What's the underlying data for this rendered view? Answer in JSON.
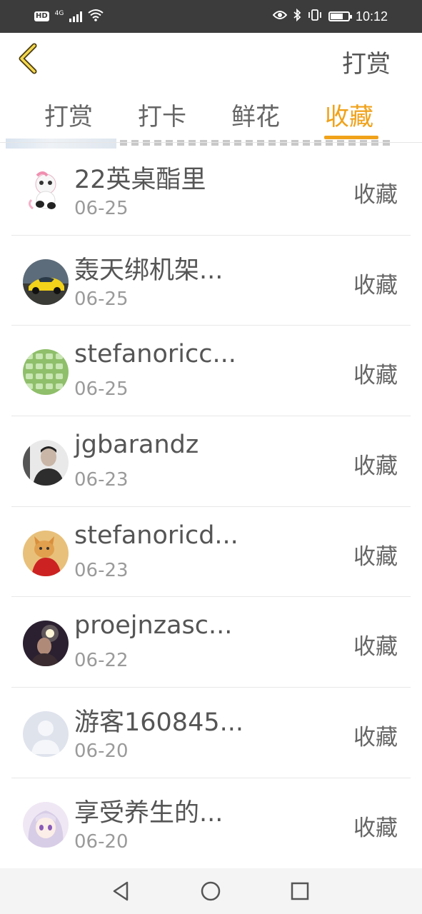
{
  "status_bar": {
    "hd_label": "HD",
    "network_label": "4G",
    "time": "10:12"
  },
  "header": {
    "title": "打赏",
    "back_icon": "chevron-left-icon"
  },
  "tabs": [
    {
      "label": "打赏",
      "active": false
    },
    {
      "label": "打卡",
      "active": false
    },
    {
      "label": "鲜花",
      "active": false
    },
    {
      "label": "收藏",
      "active": true
    }
  ],
  "accent_color": "#f0a21b",
  "list": [
    {
      "name": "22英桌酯里",
      "date": "06-25",
      "action": "收藏"
    },
    {
      "name": "轰天绑机架...",
      "date": "06-25",
      "action": "收藏"
    },
    {
      "name": "stefanoricc...",
      "date": "06-25",
      "action": "收藏"
    },
    {
      "name": "jgbarandz",
      "date": "06-23",
      "action": "收藏"
    },
    {
      "name": "stefanoricd...",
      "date": "06-23",
      "action": "收藏"
    },
    {
      "name": "proejnzasc...",
      "date": "06-22",
      "action": "收藏"
    },
    {
      "name": "游客160845...",
      "date": "06-20",
      "action": "收藏"
    },
    {
      "name": "享受养生的...",
      "date": "06-20",
      "action": "收藏"
    }
  ],
  "nav_bar": {
    "back": "triangle-back-icon",
    "home": "circle-home-icon",
    "recents": "square-recents-icon"
  }
}
